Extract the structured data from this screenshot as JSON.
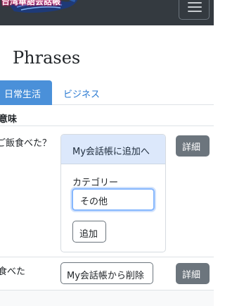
{
  "navbar": {
    "logo_text": "台湾華語会話帳",
    "menu_icon": "hamburger-icon"
  },
  "page": {
    "title": "Phrases"
  },
  "tabs": [
    {
      "label": "日常生活",
      "active": true
    },
    {
      "label": "ビジネス",
      "active": false
    }
  ],
  "table": {
    "column_header": "意味",
    "rows": [
      {
        "meaning": "ご飯食べた？",
        "card": {
          "header": "My会話帳に追加へ",
          "category_label": "カテゴリー",
          "category_value": "その他",
          "add_button": "追加"
        },
        "detail_button": "詳細"
      },
      {
        "meaning": "食べた",
        "remove_button": "My会話帳から削除",
        "detail_button": "詳細"
      }
    ]
  },
  "colors": {
    "navbar": "#343a40",
    "tab_active": "#4a90d9",
    "link": "#2a7ad2",
    "secondary_button": "#6c757d",
    "card_header": "#dce8fb"
  }
}
